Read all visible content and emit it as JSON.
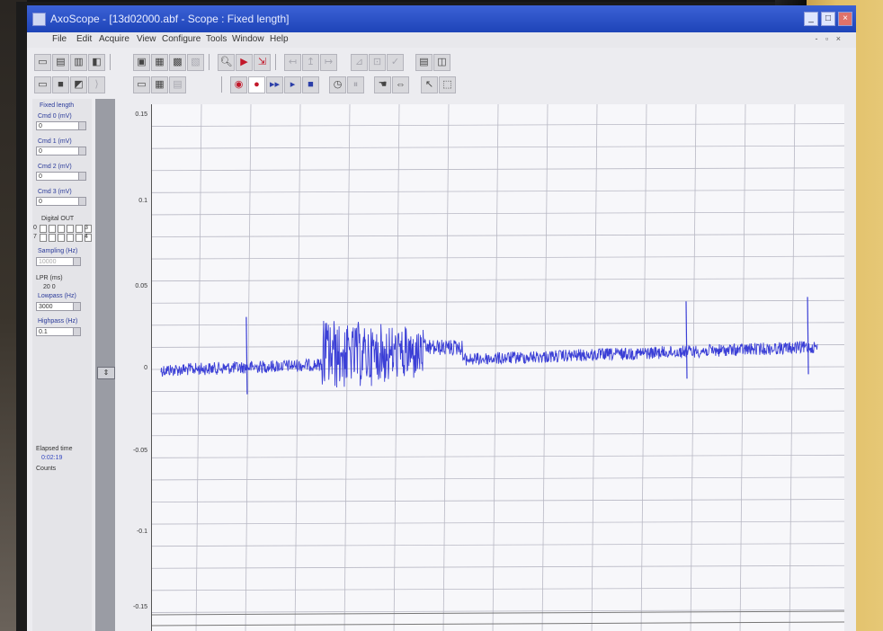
{
  "window": {
    "title": "AxoScope - [13d02000.abf - Scope : Fixed length]",
    "controls": [
      "_",
      "□",
      "×"
    ]
  },
  "menu": {
    "items": [
      "File",
      "Edit",
      "Acquire",
      "View",
      "Configure",
      "Tools",
      "Window",
      "Help"
    ],
    "mdi_controls": "- ▫ ×"
  },
  "toolbar": {
    "row1_icons": [
      "open-file-icon",
      "save-icon",
      "print-icon",
      "protocol-icon",
      "copy-icon",
      "paste-icon",
      "layout-icon",
      "zoom-icon",
      "marker-icon",
      "axis-icon",
      "arrow-left-icon",
      "arrow-up-icon",
      "arrow-right-icon",
      "check-icon",
      "grid-icon",
      "split-icon"
    ],
    "row2_icons": [
      "open-icon",
      "save-data-icon",
      "export-icon",
      "cursor-icon",
      "window-icon",
      "table-icon",
      "record-icon",
      "stop-record-icon",
      "fast-play-icon",
      "play-icon",
      "stop-icon",
      "clock-icon",
      "hand-icon",
      "pointer-icon"
    ]
  },
  "left_panel": {
    "mode_label": "Fixed length",
    "channels": [
      {
        "label": "Cmd 0 (mV)",
        "value": "0"
      },
      {
        "label": "Cmd 1 (mV)",
        "value": "0"
      },
      {
        "label": "Cmd 2 (mV)",
        "value": "0"
      },
      {
        "label": "Cmd 3 (mV)",
        "value": "0"
      }
    ],
    "digital_label": "Digital OUT",
    "digital_left": [
      "0",
      "7"
    ],
    "digital_right": [
      "3",
      "4"
    ],
    "sampling_label": "Sampling (Hz)",
    "sampling_value": "10000",
    "lowpass_label": "Lowpass (Hz)",
    "lowpass_value": "3000",
    "highpass_label": "Highpass (Hz)",
    "highpass_value": "0.1",
    "tag_label": "LPR (ms)",
    "tag_value": "20 0",
    "elapsed_label": "Elapsed time",
    "elapsed_value": "0:02:19",
    "counts_label": "Counts"
  },
  "y_axis": {
    "ticks": [
      "0.15",
      "0.1",
      "0.05",
      "0",
      "-0.05",
      "-0.1",
      "-0.15"
    ]
  },
  "trace": {
    "color": "#3b3fd6",
    "baseline": 0,
    "burst_start": 0.245,
    "burst_end": 0.4,
    "spikes": [
      0.13,
      0.8,
      0.985
    ]
  },
  "colors": {
    "title_bar": "#2a4fc8",
    "plot_bg": "#f7f7fa",
    "grid": "#b8b8c4"
  }
}
